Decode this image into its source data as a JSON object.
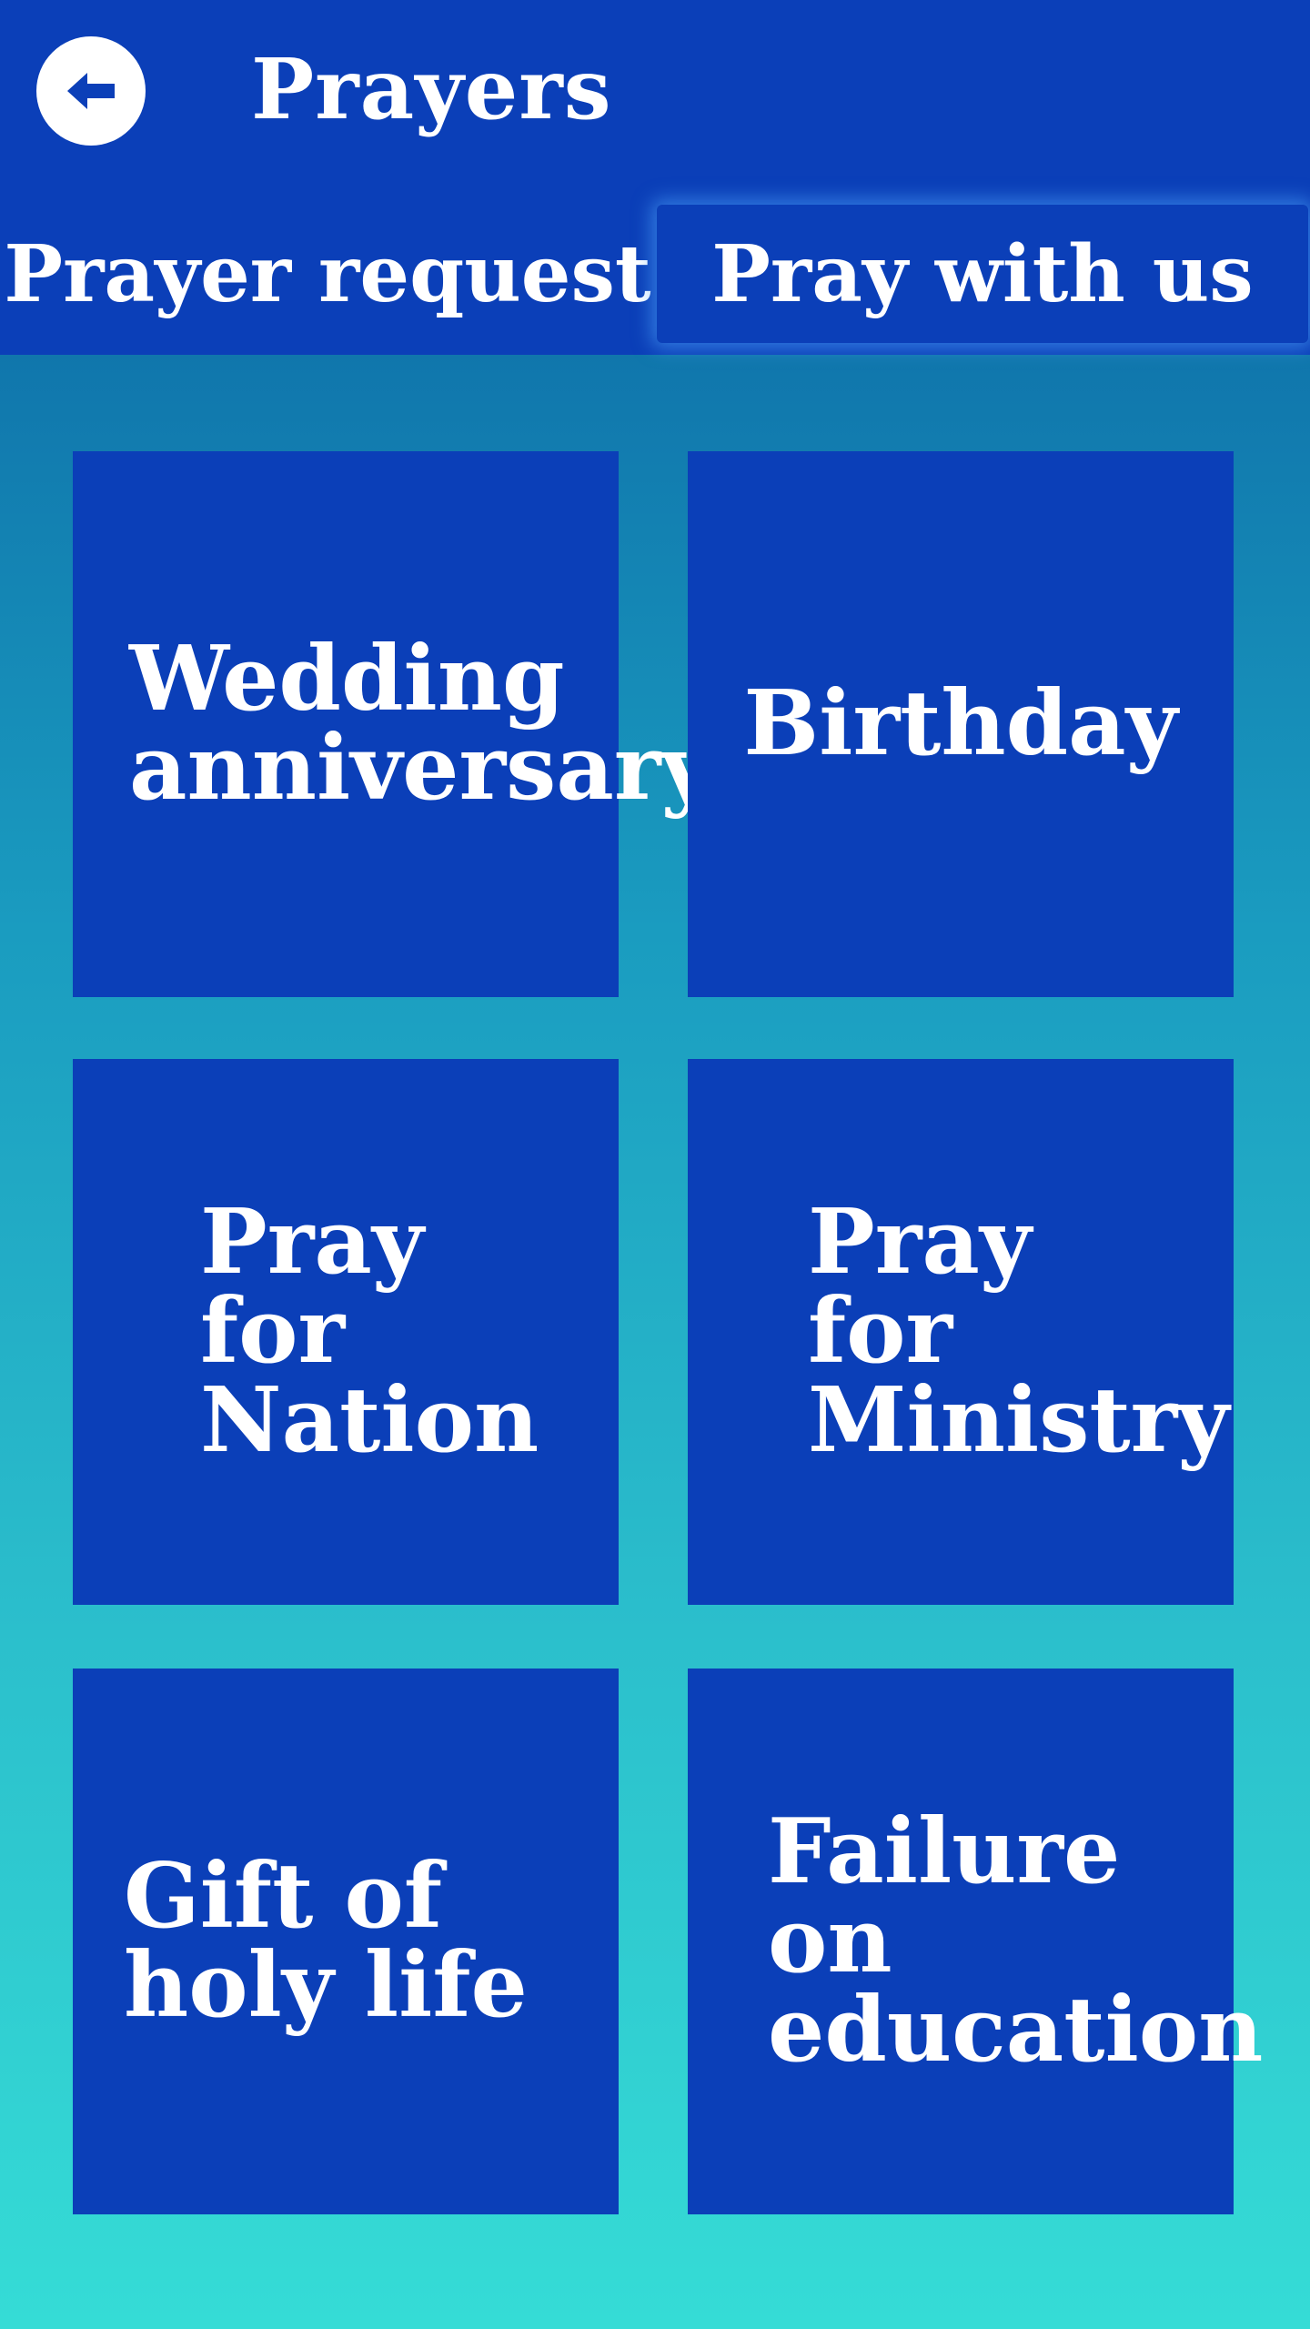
{
  "header": {
    "title": "Prayers",
    "back_icon": "arrow-left-icon"
  },
  "tabs": [
    {
      "label": "Prayer request",
      "active": false
    },
    {
      "label": "Pray with us",
      "active": true
    }
  ],
  "categories": [
    {
      "label": "Wedding anniversary"
    },
    {
      "label": "Birthday"
    },
    {
      "label": "Pray for Nation"
    },
    {
      "label": "Pray for Ministry"
    },
    {
      "label": "Gift of holy life"
    },
    {
      "label": "Failure on education"
    }
  ],
  "colors": {
    "primary": "#0b3fb8",
    "gradient_top": "#0a5fa0",
    "gradient_bottom": "#35dcd6",
    "text": "#ffffff"
  }
}
